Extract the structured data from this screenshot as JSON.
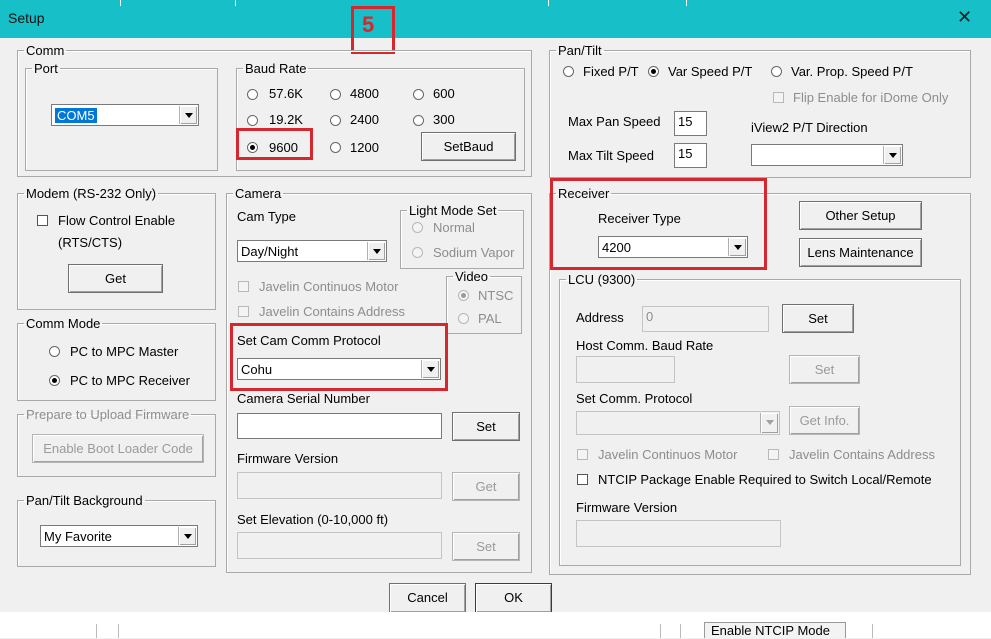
{
  "window": {
    "title": "Setup",
    "close": "✕"
  },
  "annotation_number": "5",
  "comm": {
    "legend": "Comm",
    "port_legend": "Port",
    "port_value": "COM5",
    "baud_legend": "Baud Rate",
    "baud_options": [
      "57.6K",
      "4800",
      "600",
      "19.2K",
      "2400",
      "300",
      "9600",
      "1200"
    ],
    "setbaud": "SetBaud"
  },
  "modem": {
    "legend": "Modem (RS-232 Only)",
    "flow_line1": "Flow Control Enable",
    "flow_line2": "(RTS/CTS)",
    "get": "Get"
  },
  "comm_mode": {
    "legend": "Comm Mode",
    "master": "PC to MPC Master",
    "receiver": "PC to MPC Receiver"
  },
  "firmware_upload": {
    "legend": "Prepare to Upload Firmware",
    "enable_boot": "Enable Boot Loader Code"
  },
  "pt_background": {
    "legend": "Pan/Tilt Background",
    "value": "My Favorite"
  },
  "camera": {
    "legend": "Camera",
    "cam_type_label": "Cam Type",
    "cam_type_value": "Day/Night",
    "light_legend": "Light Mode Set",
    "light_normal": "Normal",
    "light_sodium": "Sodium Vapor",
    "javelin_motor": "Javelin Continuos Motor",
    "javelin_address": "Javelin Contains Address",
    "video_legend": "Video",
    "ntsc": "NTSC",
    "pal": "PAL",
    "protocol_label": "Set Cam Comm Protocol",
    "protocol_value": "Cohu",
    "serial_label": "Camera Serial Number",
    "serial_value": "",
    "set": "Set",
    "firmware_label": "Firmware Version",
    "get": "Get",
    "elevation_label": "Set Elevation (0-10,000 ft)"
  },
  "pantilt": {
    "legend": "Pan/Tilt",
    "fixed": "Fixed P/T",
    "var": "Var Speed P/T",
    "varprop": "Var. Prop. Speed P/T",
    "flip": "Flip Enable for iDome Only",
    "max_pan_label": "Max Pan Speed",
    "max_pan_value": "15",
    "max_tilt_label": "Max Tilt Speed",
    "max_tilt_value": "15",
    "direction_label": "iView2 P/T Direction"
  },
  "receiver": {
    "legend": "Receiver",
    "type_label": "Receiver Type",
    "type_value": "4200",
    "other_setup": "Other Setup",
    "lens_maint": "Lens Maintenance"
  },
  "lcu": {
    "legend": "LCU (9300)",
    "address_label": "Address",
    "address_value": "0",
    "set": "Set",
    "host_baud_label": "Host Comm. Baud Rate",
    "protocol_label": "Set Comm. Protocol",
    "get_info": "Get Info.",
    "javelin_motor": "Javelin Continuos Motor",
    "javelin_address": "Javelin Contains Address",
    "ntcip": "NTCIP Package Enable Required to Switch Local/Remote",
    "firmware_label": "Firmware Version"
  },
  "footer": {
    "cancel": "Cancel",
    "ok": "OK",
    "behind_text": "Enable NTCIP Mode"
  },
  "colors": {
    "titlebar": "#17bfc8",
    "annotation": "#d4282e",
    "selection": "#0078d7"
  }
}
